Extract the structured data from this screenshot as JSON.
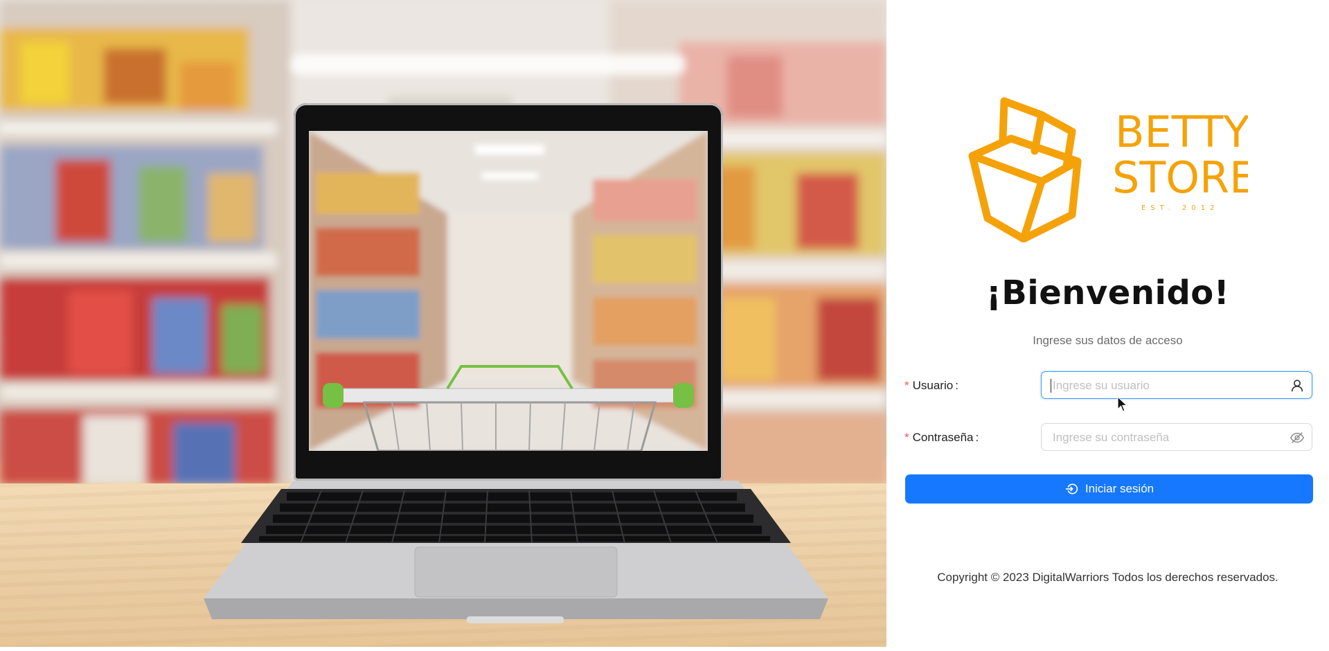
{
  "brand": {
    "name_line1": "BETTY",
    "name_line2": "STORE",
    "established": "EST. 2012",
    "color": "#f5a20a"
  },
  "welcome": {
    "title": "¡Bienvenido!",
    "subtitle": "Ingrese sus datos de acceso"
  },
  "form": {
    "username": {
      "label": "Usuario",
      "required_mark": "*",
      "placeholder": "Ingrese su usuario",
      "value": "",
      "icon": "user-icon"
    },
    "password": {
      "label": "Contraseña",
      "required_mark": "*",
      "placeholder": "Ingrese su contraseña",
      "value": "",
      "icon": "eye-invisible-icon"
    },
    "submit": {
      "label": "Iniciar sesión",
      "icon": "login-icon",
      "color": "#1677ff"
    }
  },
  "footer": {
    "copyright": "Copyright © 2023 DigitalWarriors Todos los derechos reservados."
  }
}
